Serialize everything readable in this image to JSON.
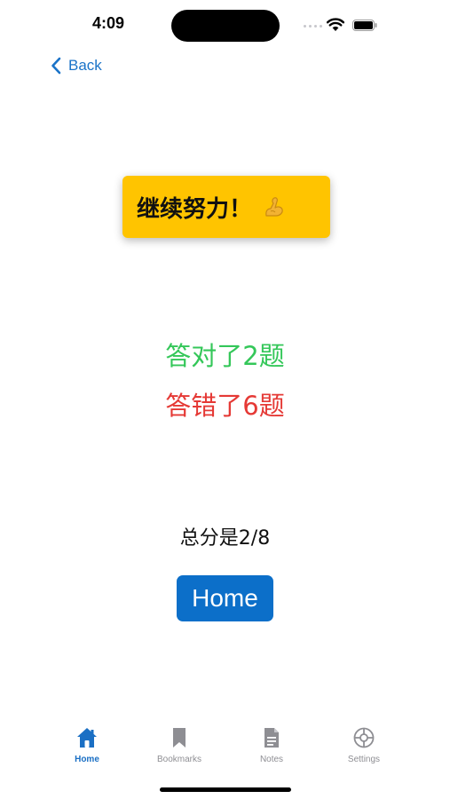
{
  "status_bar": {
    "time": "4:09"
  },
  "nav": {
    "back_label": "Back"
  },
  "banner": {
    "text": "继续努力！",
    "icon": "flexed-biceps-icon"
  },
  "results": {
    "correct_text": "答对了2题",
    "wrong_text": "答错了6题"
  },
  "score": {
    "text": "总分是2/8"
  },
  "home_button": {
    "label": "Home"
  },
  "tabs": [
    {
      "label": "Home",
      "icon": "house-icon",
      "active": true
    },
    {
      "label": "Bookmarks",
      "icon": "bookmark-icon",
      "active": false
    },
    {
      "label": "Notes",
      "icon": "document-icon",
      "active": false
    },
    {
      "label": "Settings",
      "icon": "gear-icon",
      "active": false
    }
  ],
  "colors": {
    "accent": "#0c6fc9",
    "banner": "#ffc400",
    "correct": "#34c759",
    "wrong": "#e53935",
    "tab_inactive": "#8e8e93"
  }
}
